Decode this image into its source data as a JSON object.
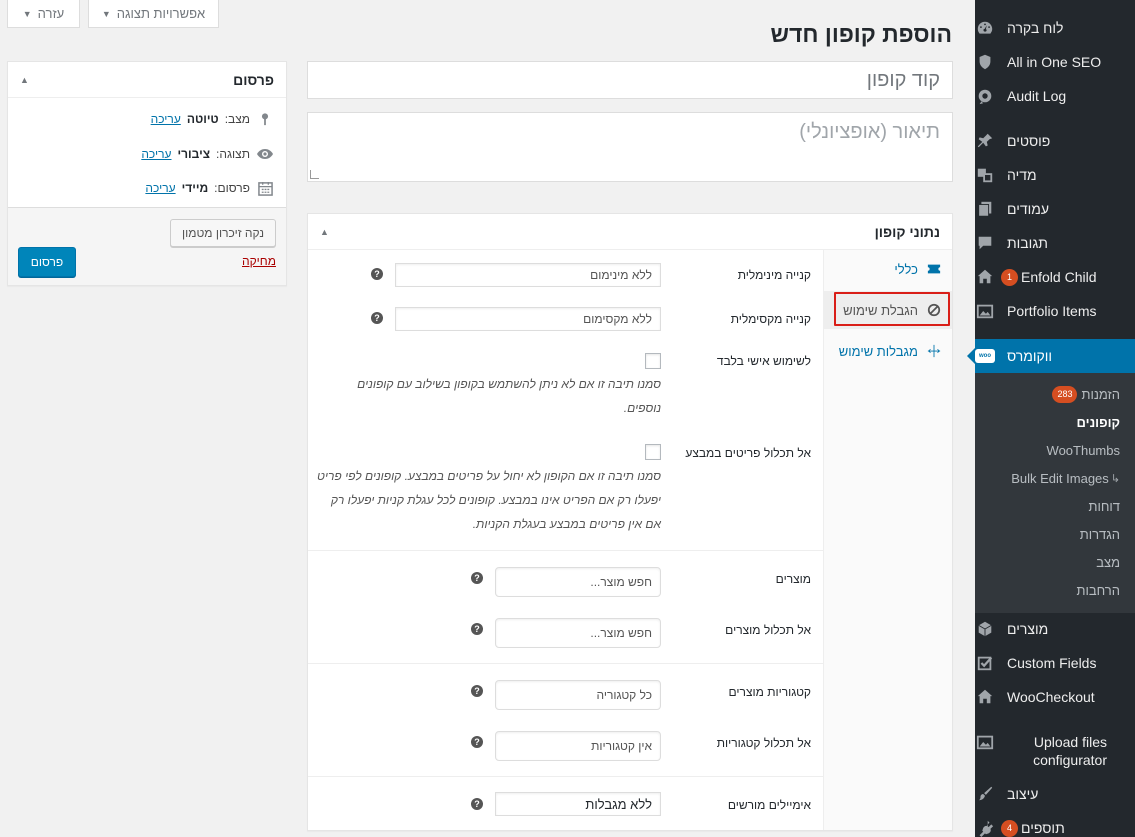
{
  "sidebar": {
    "items": [
      {
        "label": "לוח בקרה",
        "icon": "dashboard-icon"
      },
      {
        "label": "All in One SEO",
        "icon": "shield-icon"
      },
      {
        "label": "Audit Log",
        "icon": "audit-log-icon"
      },
      {
        "label": "פוסטים",
        "icon": "pin-icon"
      },
      {
        "label": "מדיה",
        "icon": "media-icon"
      },
      {
        "label": "עמודים",
        "icon": "pages-icon"
      },
      {
        "label": "תגובות",
        "icon": "comments-icon"
      },
      {
        "label": "Enfold Child",
        "icon": "home-icon",
        "badge": "1"
      },
      {
        "label": "Portfolio Items",
        "icon": "portfolio-icon"
      },
      {
        "label": "ווקומרס",
        "icon": "woo-icon"
      },
      {
        "label": "מוצרים",
        "icon": "box-icon"
      },
      {
        "label": "Custom Fields",
        "icon": "checkbox-icon"
      },
      {
        "label": "WooCheckout",
        "icon": "home-icon"
      },
      {
        "label": "Upload files configurator",
        "icon": "gallery-icon"
      },
      {
        "label": "עיצוב",
        "icon": "brush-icon"
      },
      {
        "label": "תוספים",
        "icon": "plugin-icon",
        "badge": "4"
      }
    ],
    "submenu": [
      {
        "label": "הזמנות",
        "badge": "283"
      },
      {
        "label": "קופונים"
      },
      {
        "label": "WooThumbs"
      },
      {
        "label": "Bulk Edit Images"
      },
      {
        "label": "דוחות"
      },
      {
        "label": "הגדרות"
      },
      {
        "label": "מצב"
      },
      {
        "label": "הרחבות"
      }
    ],
    "woo_icon_text": "woo"
  },
  "screen_meta": {
    "options_label": "אפשרויות תצוגה",
    "help_label": "עזרה"
  },
  "page": {
    "title": "הוספת קופון חדש",
    "coupon_code_placeholder": "קוד קופון",
    "description_placeholder": "תיאור (אופציונלי)"
  },
  "coupon_data": {
    "title": "נתוני קופון",
    "tabs": [
      {
        "label": "כללי",
        "icon": "ticket-icon"
      },
      {
        "label": "הגבלת שימוש",
        "icon": "block-icon"
      },
      {
        "label": "מגבלות שימוש",
        "icon": "limits-icon"
      }
    ],
    "fields": {
      "min_spend_label": "קנייה מינימלית",
      "min_spend_placeholder": "ללא מינימום",
      "max_spend_label": "קנייה מקסימלית",
      "max_spend_placeholder": "ללא מקסימום",
      "individual_label": "לשימוש אישי בלבד",
      "individual_desc": "סמנו תיבה זו אם לא ניתן להשתמש בקופון בשילוב עם קופונים נוספים.",
      "exclude_sale_label": "אל תכלול פריטים במבצע",
      "exclude_sale_desc": "סמנו תיבה זו אם הקופון לא יחול על פריטים במבצע. קופונים לפי פריט יפעלו רק אם הפריט אינו במבצע. קופונים לכל עגלת קניות יפעלו רק אם אין פריטים במבצע בעגלת הקניות.",
      "products_label": "מוצרים",
      "products_placeholder": "חפש מוצר...",
      "exclude_products_label": "אל תכלול מוצרים",
      "exclude_products_placeholder": "חפש מוצר...",
      "categories_label": "קטגוריות מוצרים",
      "categories_placeholder": "כל קטגוריה",
      "exclude_categories_label": "אל תכלול קטגוריות",
      "exclude_categories_placeholder": "אין קטגוריות",
      "emails_label": "אימיילים מורשים",
      "emails_placeholder": "ללא מגבלות",
      "help_glyph": "?"
    }
  },
  "publish": {
    "title": "פרסום",
    "status_label": "מצב:",
    "status_value": "טיוטה",
    "visibility_label": "תצוגה:",
    "visibility_value": "ציבורי",
    "publish_label": "פרסום:",
    "publish_value": "מיידי",
    "edit_link": "עריכה",
    "clear_cache": "נקה זיכרון מטמון",
    "delete_link": "מחיקה",
    "publish_button": "פרסום"
  },
  "colors": {
    "sidebar_bg": "#23282d",
    "sidebar_active": "#0073aa",
    "submenu_bg": "#32373c",
    "primary_button": "#0085ba",
    "highlight_border": "#d91e18",
    "badge": "#d54e21"
  }
}
